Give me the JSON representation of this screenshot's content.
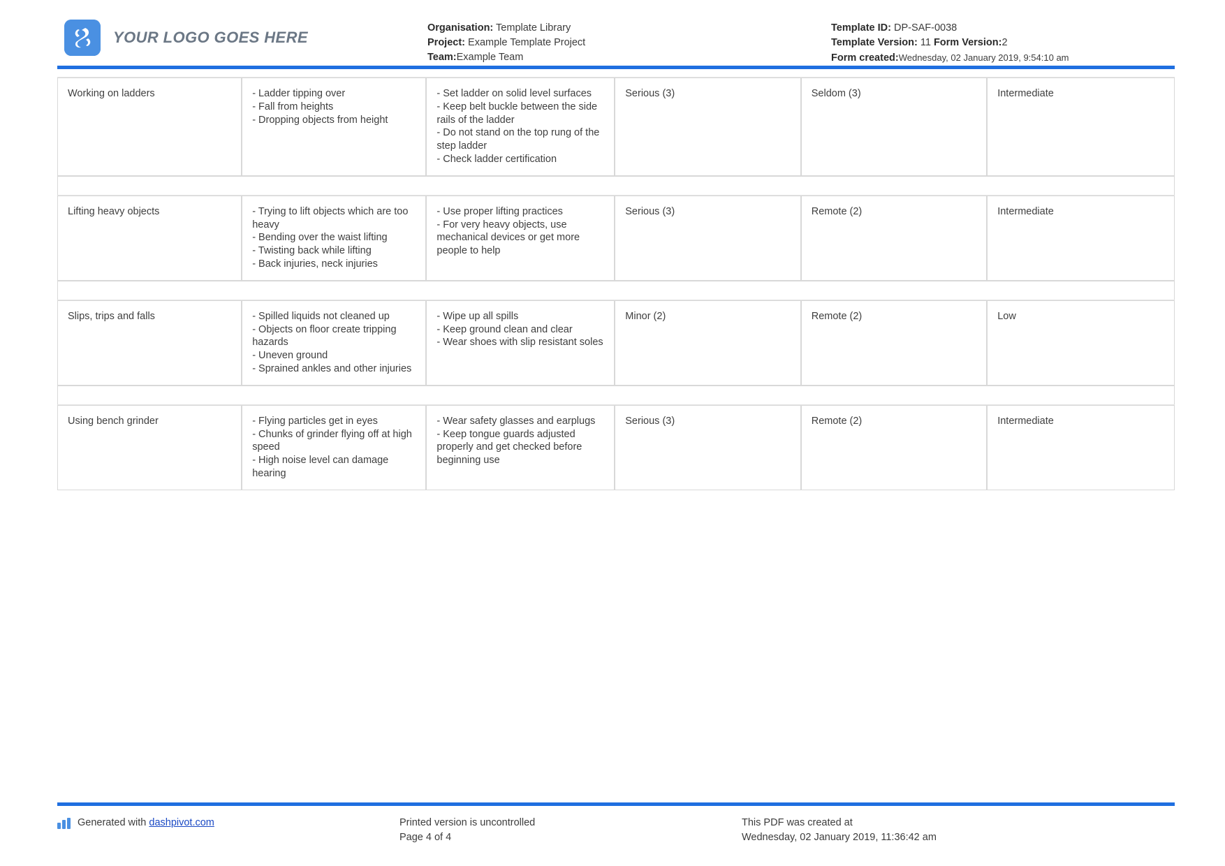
{
  "header": {
    "logo": {
      "icon": "logo-s-mark",
      "text": "YOUR LOGO GOES HERE",
      "color": "#4a90e2"
    },
    "center": {
      "organisation_label": "Organisation:",
      "organisation_value": "Template Library",
      "project_label": "Project:",
      "project_value": "Example Template Project",
      "team_label": "Team:",
      "team_value": "Example Team"
    },
    "right": {
      "template_id_label": "Template ID:",
      "template_id_value": "DP-SAF-0038",
      "template_version_label": "Template Version:",
      "template_version_value": "11",
      "form_version_label": "Form Version:",
      "form_version_value": "2",
      "form_created_label": "Form created:",
      "form_created_value": "Wednesday, 02 January 2019, 9:54:10 am"
    },
    "rule_color": "#1f6fe0"
  },
  "table": {
    "rows": [
      {
        "activity": "Working on ladders",
        "hazards": [
          "- Ladder tipping over",
          "- Fall from heights",
          "- Dropping objects from height"
        ],
        "controls": [
          "- Set ladder on solid level surfaces",
          "- Keep belt buckle between the side rails of the ladder",
          "- Do not stand on the top rung of the step ladder",
          "- Check ladder certification"
        ],
        "consequence": "Serious (3)",
        "likelihood": "Seldom (3)",
        "risk_rating": "Intermediate"
      },
      {
        "activity": "Lifting heavy objects",
        "hazards": [
          "- Trying to lift objects which are too heavy",
          "- Bending over the waist lifting",
          "- Twisting back while lifting",
          "- Back injuries, neck injuries"
        ],
        "controls": [
          "- Use proper lifting practices",
          "- For very heavy objects, use mechanical devices or get more people to help"
        ],
        "consequence": "Serious (3)",
        "likelihood": "Remote (2)",
        "risk_rating": "Intermediate"
      },
      {
        "activity": "Slips, trips and falls",
        "hazards": [
          "- Spilled liquids not cleaned up",
          "- Objects on floor create tripping hazards",
          "- Uneven ground",
          "- Sprained ankles and other injuries"
        ],
        "controls": [
          "- Wipe up all spills",
          "- Keep ground clean and clear",
          "- Wear shoes with slip resistant soles"
        ],
        "consequence": "Minor (2)",
        "likelihood": "Remote (2)",
        "risk_rating": "Low"
      },
      {
        "activity": "Using bench grinder",
        "hazards": [
          "- Flying particles get in eyes",
          "- Chunks of grinder flying off at high speed",
          "- High noise level can damage hearing"
        ],
        "controls": [
          "- Wear safety glasses and earplugs",
          "- Keep tongue guards adjusted properly and get checked before beginning use"
        ],
        "consequence": "Serious (3)",
        "likelihood": "Remote (2)",
        "risk_rating": "Intermediate"
      }
    ]
  },
  "footer": {
    "generated_prefix": "Generated with",
    "generated_link": "dashpivot.com",
    "print_notice": "Printed version is uncontrolled",
    "page_number": "Page 4 of 4",
    "pdf_created_label": "This PDF was created at",
    "pdf_created_value": "Wednesday, 02 January 2019, 11:36:42 am",
    "rule_color": "#1f6fe0",
    "icon": "bar-chart-icon"
  }
}
